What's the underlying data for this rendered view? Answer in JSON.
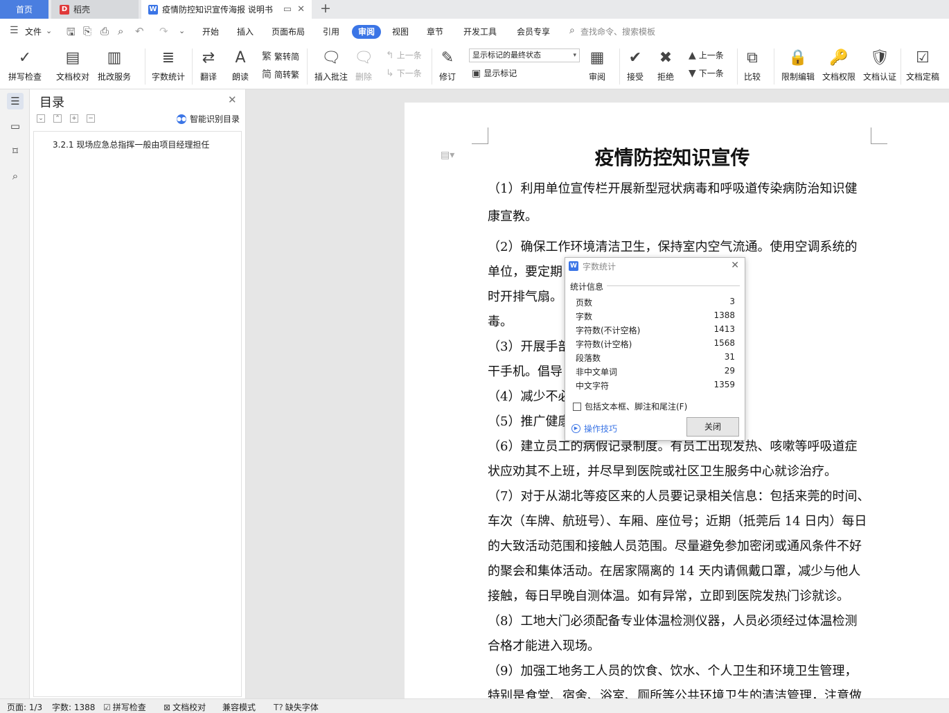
{
  "tabs": {
    "home": "首页",
    "daoke": "稻壳",
    "doc": "疫情防控知识宣传海报 说明书"
  },
  "menu": {
    "file": "文件",
    "items": [
      "开始",
      "插入",
      "页面布局",
      "引用",
      "审阅",
      "视图",
      "章节",
      "开发工具",
      "会员专享"
    ],
    "search": "查找命令、搜索模板"
  },
  "ribbon": {
    "spellcheck": "拼写检查",
    "proofread": "文档校对",
    "revise_service": "批改服务",
    "wordcount": "字数统计",
    "translate": "翻译",
    "read_aloud": "朗读",
    "trad_to_simp": "繁转简",
    "simp_to_trad": "简转繁",
    "insert_comment": "插入批注",
    "delete": "删除",
    "prev": "上一条",
    "next": "下一条",
    "track": "修订",
    "markup_state": "显示标记的最终状态",
    "show_markup": "显示标记",
    "review": "审阅",
    "accept": "接受",
    "reject": "拒绝",
    "prev2": "上一条",
    "next2": "下一条",
    "compare": "比较",
    "restrict": "限制编辑",
    "permission": "文档权限",
    "certify": "文档认证",
    "finalize": "文档定稿"
  },
  "nav": {
    "title": "目录",
    "smart": "智能识别目录",
    "item": "3.2.1 现场应急总指挥一般由项目经理担任"
  },
  "doc": {
    "title": "疫情防控知识宣传",
    "lines": [
      "（1）利用单位宣传栏开展新型冠状病毒和呼吸道传染病防治知识健",
      "康宣教。",
      "（2）确保工作环境清洁卫生，保持室内空气流通。使用空调系统的",
      "单位，要定期                                       换气。开空調时，可同",
      "时开排气扇。                                       把手和电梯按钮进行消",
      "毒。",
      "（3）开展手部                                       龙头、洗手液抹手纸或",
      "干手机。倡导",
      "（4）减少不必                                       等活动。",
      "（5）推广健康                                       尽量不加班。",
      "（6）建立员工的病假记录制度。有员工出现发热、咳嗽等呼吸道症",
      "状应劝其不上班，并尽早到医院或社区卫生服务中心就诊治疗。",
      "（7）对于从湖北等疫区来的人员要记录相关信息：包括来莞的时间、",
      "车次（车牌、航班号）、车厢、座位号；近期（抵莞后 14 日内）每日",
      "的大致活动范围和接触人员范围。尽量避免参加密闭或通风条件不好",
      "的聚会和集体活动。在居家隔离的 14 天内请佩戴口罩，减少与他人",
      "接触，每日早晚自测体温。如有异常，立即到医院发热门诊就诊。",
      "（8）工地大门必须配备专业体温检测仪器，人员必须经过体温检测",
      "合格才能进入现场。",
      "（9）加强工地务工人员的饮食、饮水、个人卫生和环境卫生管理，",
      "特别是食堂、宿舍、浴室、厕所等公共环境卫生的清洁管理，注意做"
    ]
  },
  "dialog": {
    "title": "字数统计",
    "group": "统计信息",
    "rows": [
      {
        "label": "页数",
        "value": "3"
      },
      {
        "label": "字数",
        "value": "1388"
      },
      {
        "label": "字符数(不计空格)",
        "value": "1413"
      },
      {
        "label": "字符数(计空格)",
        "value": "1568"
      },
      {
        "label": "段落数",
        "value": "31"
      },
      {
        "label": "非中文单词",
        "value": "29"
      },
      {
        "label": "中文字符",
        "value": "1359"
      }
    ],
    "include": "包括文本框、脚注和尾注(F)",
    "tips": "操作技巧",
    "close": "关闭"
  },
  "status": {
    "page": "页面: 1/3",
    "words": "字数: 1388",
    "spell": "拼写检查",
    "proof": "文档校对",
    "compat": "兼容模式",
    "missing_font": "缺失字体"
  }
}
